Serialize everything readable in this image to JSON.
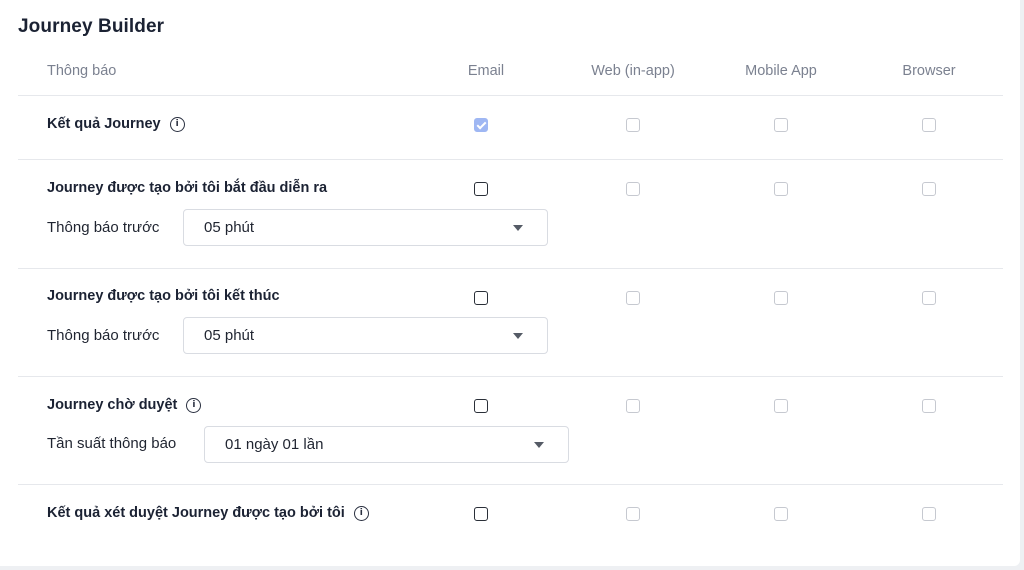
{
  "section_title": "Journey Builder",
  "columns": {
    "notification": "Thông báo",
    "email": "Email",
    "web": "Web (in-app)",
    "mobile": "Mobile App",
    "browser": "Browser"
  },
  "rows": [
    {
      "label": "Kết quả Journey",
      "has_info": true,
      "email": "checked-disabled"
    },
    {
      "label": "Journey được tạo bởi tôi bắt đầu diễn ra",
      "has_info": false,
      "email": "unchecked",
      "sub": {
        "label": "Thông báo trước",
        "value": "05 phút"
      }
    },
    {
      "label": "Journey được tạo bởi tôi kết thúc",
      "has_info": false,
      "email": "unchecked",
      "sub": {
        "label": "Thông báo trước",
        "value": "05 phút"
      }
    },
    {
      "label": "Journey chờ duyệt",
      "has_info": true,
      "email": "unchecked",
      "sub": {
        "label": "Tần suất thông báo",
        "value": "01 ngày 01 lần"
      }
    },
    {
      "label": "Kết quả xét duyệt Journey được tạo bởi tôi",
      "has_info": true,
      "email": "unchecked"
    }
  ],
  "info_glyph": "i"
}
